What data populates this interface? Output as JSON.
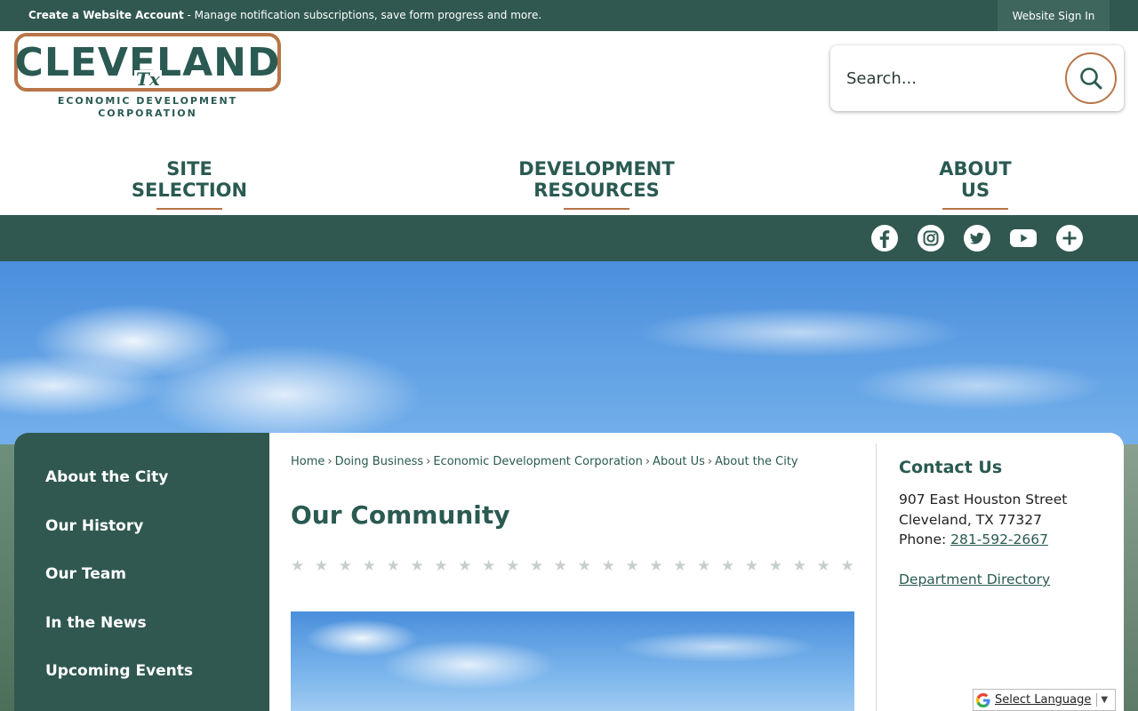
{
  "topbar": {
    "create_account": "Create a Website Account",
    "message": " - Manage notification subscriptions, save form progress and more.",
    "sign_in": "Website Sign In"
  },
  "logo": {
    "wordmark": "CLEVELAND",
    "state": "Tx",
    "line1": "ECONOMIC DEVELOPMENT",
    "line2": "CORPORATION"
  },
  "search": {
    "placeholder": "Search..."
  },
  "nav": {
    "items": [
      {
        "label": "SITE SELECTION"
      },
      {
        "label": "DEVELOPMENT RESOURCES"
      },
      {
        "label": "ABOUT US"
      }
    ]
  },
  "social": {
    "icons": [
      "facebook-icon",
      "instagram-icon",
      "twitter-icon",
      "youtube-icon",
      "plus-icon"
    ]
  },
  "sidebar": {
    "items": [
      {
        "label": "About the City"
      },
      {
        "label": "Our History"
      },
      {
        "label": "Our Team"
      },
      {
        "label": "In the News"
      },
      {
        "label": "Upcoming Events"
      }
    ]
  },
  "breadcrumb": {
    "items": [
      "Home",
      "Doing Business",
      "Economic Development Corporation",
      "About Us"
    ],
    "current": "About the City",
    "separator": "›"
  },
  "main": {
    "title": "Our Community",
    "star_count": 24,
    "star_glyph": "★"
  },
  "contact": {
    "title": "Contact Us",
    "address1": "907 East Houston Street",
    "address2": "Cleveland, TX 77327",
    "phone_label": "Phone: ",
    "phone": "281-592-2667",
    "directory": "Department Directory"
  },
  "translate": {
    "label": "Select Language"
  },
  "colors": {
    "primary": "#305850",
    "accent": "#b87547",
    "text_green": "#2a5a52"
  }
}
